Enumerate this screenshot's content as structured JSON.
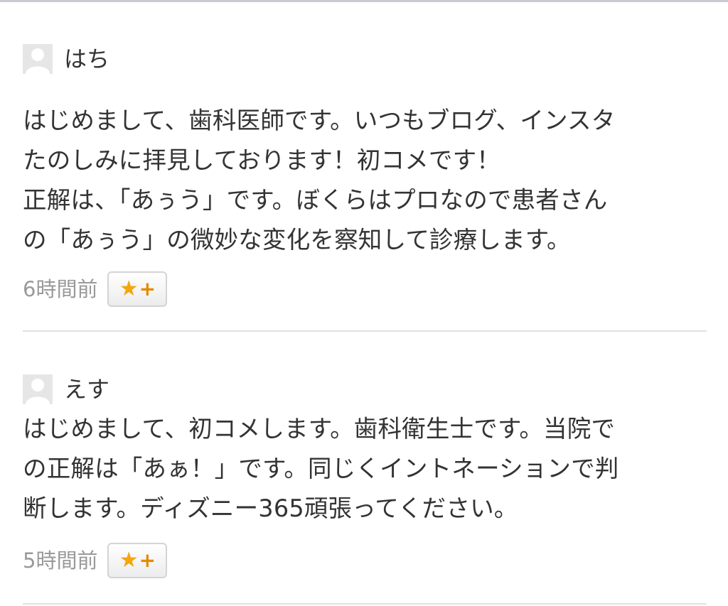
{
  "comments": [
    {
      "username": "はち",
      "body_lines": [
        "はじめまして、歯科医師です。いつもブログ、インスタ",
        "たのしみに拝見しております！初コメです！",
        "正解は、「あぅう」です。ぼくらはプロなので患者さん",
        "の「あぅう」の微妙な変化を察知して診療します。"
      ],
      "time": "6時間前",
      "star_label": "★",
      "plus_label": "+"
    },
    {
      "username": "えす",
      "body_lines": [
        "はじめまして、初コメします。歯科衛生士です。当院で",
        "の正解は「あぁ！」です。同じくイントネーションで判",
        "断します。ディズニー365頑張ってください。"
      ],
      "time": "5時間前",
      "star_label": "★",
      "plus_label": "+"
    }
  ],
  "icons": {
    "avatar": "default-user-avatar",
    "star": "star-plus-button"
  },
  "colors": {
    "text": "#333333",
    "timestamp": "#9a9a9a",
    "star": "#f2a60f",
    "divider": "#e1e1e1"
  }
}
